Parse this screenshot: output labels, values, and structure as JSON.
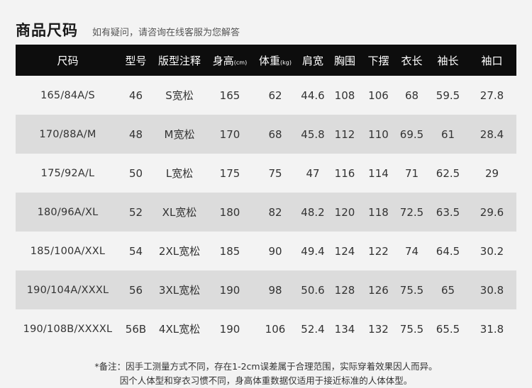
{
  "header": {
    "title": "商品尺码",
    "subtitle": "如有疑问，请咨询在线客服为您解答"
  },
  "table": {
    "columns": [
      {
        "label": "尺码",
        "unit": ""
      },
      {
        "label": "型号",
        "unit": ""
      },
      {
        "label": "版型注释",
        "unit": ""
      },
      {
        "label": "身高",
        "unit": "(cm)"
      },
      {
        "label": "体重",
        "unit": "(kg)"
      },
      {
        "label": "肩宽",
        "unit": ""
      },
      {
        "label": "胸围",
        "unit": ""
      },
      {
        "label": "下摆",
        "unit": ""
      },
      {
        "label": "衣长",
        "unit": ""
      },
      {
        "label": "袖长",
        "unit": ""
      },
      {
        "label": "袖口",
        "unit": ""
      }
    ],
    "rows": [
      [
        "165/84A/S",
        "46",
        "S宽松",
        "165",
        "62",
        "44.6",
        "108",
        "106",
        "68",
        "59.5",
        "27.8"
      ],
      [
        "170/88A/M",
        "48",
        "M宽松",
        "170",
        "68",
        "45.8",
        "112",
        "110",
        "69.5",
        "61",
        "28.4"
      ],
      [
        "175/92A/L",
        "50",
        "L宽松",
        "175",
        "75",
        "47",
        "116",
        "114",
        "71",
        "62.5",
        "29"
      ],
      [
        "180/96A/XL",
        "52",
        "XL宽松",
        "180",
        "82",
        "48.2",
        "120",
        "118",
        "72.5",
        "63.5",
        "29.6"
      ],
      [
        "185/100A/XXL",
        "54",
        "2XL宽松",
        "185",
        "90",
        "49.4",
        "124",
        "122",
        "74",
        "64.5",
        "30.2"
      ],
      [
        "190/104A/XXXL",
        "56",
        "3XL宽松",
        "190",
        "98",
        "50.6",
        "128",
        "126",
        "75.5",
        "65",
        "30.8"
      ],
      [
        "190/108B/XXXXL",
        "56B",
        "4XL宽松",
        "190",
        "106",
        "52.4",
        "134",
        "132",
        "75.5",
        "65.5",
        "31.8"
      ]
    ]
  },
  "notes": [
    "*备注：因手工测量方式不同，存在1-2cm误差属于合理范围，实际穿着效果因人而异。",
    "因个人体型和穿衣习惯不同，身高体重数据仅适用于接近标准的人体体型。"
  ],
  "colors": {
    "header_bg": "#0d0d0d",
    "row_shade": "#dcdcdc",
    "page_bg": "#f3f3f3"
  },
  "chart_data": {
    "type": "table",
    "columns": [
      "尺码",
      "型号",
      "版型注释",
      "身高(cm)",
      "体重(kg)",
      "肩宽",
      "胸围",
      "下摆",
      "衣长",
      "袖长",
      "袖口"
    ],
    "rows": [
      [
        "165/84A/S",
        "46",
        "S宽松",
        165,
        62,
        44.6,
        108,
        106,
        68,
        59.5,
        27.8
      ],
      [
        "170/88A/M",
        "48",
        "M宽松",
        170,
        68,
        45.8,
        112,
        110,
        69.5,
        61,
        28.4
      ],
      [
        "175/92A/L",
        "50",
        "L宽松",
        175,
        75,
        47,
        116,
        114,
        71,
        62.5,
        29
      ],
      [
        "180/96A/XL",
        "52",
        "XL宽松",
        180,
        82,
        48.2,
        120,
        118,
        72.5,
        63.5,
        29.6
      ],
      [
        "185/100A/XXL",
        "54",
        "2XL宽松",
        185,
        90,
        49.4,
        124,
        122,
        74,
        64.5,
        30.2
      ],
      [
        "190/104A/XXXL",
        "56",
        "3XL宽松",
        190,
        98,
        50.6,
        128,
        126,
        75.5,
        65,
        30.8
      ],
      [
        "190/108B/XXXXL",
        "56B",
        "4XL宽松",
        190,
        106,
        52.4,
        134,
        132,
        75.5,
        65.5,
        31.8
      ]
    ]
  }
}
